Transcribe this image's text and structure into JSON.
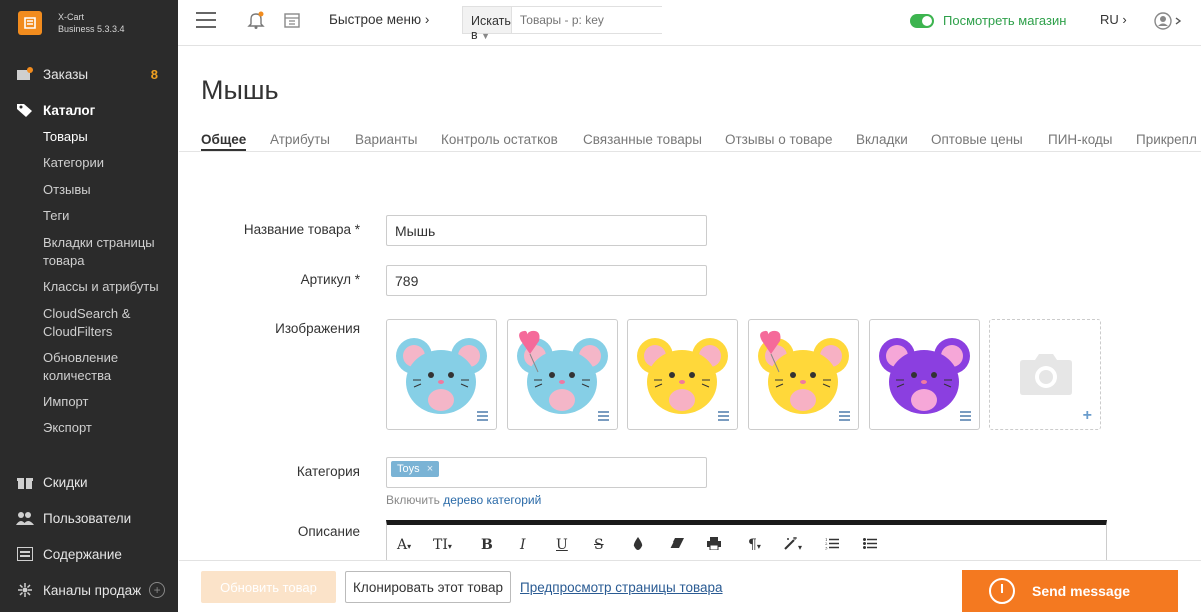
{
  "brand": {
    "name": "X-Cart",
    "edition": "Business 5.3.3.4"
  },
  "sidebar": {
    "orders": {
      "label": "Заказы",
      "badge": "8"
    },
    "catalog": {
      "label": "Каталог"
    },
    "catalog_items": [
      {
        "label": "Товары"
      },
      {
        "label": "Категории"
      },
      {
        "label": "Отзывы"
      },
      {
        "label": "Теги"
      },
      {
        "label": "Вкладки страницы товара"
      },
      {
        "label": "Классы и атрибуты"
      },
      {
        "label": "CloudSearch & CloudFilters"
      },
      {
        "label": "Обновление количества"
      },
      {
        "label": "Импорт"
      },
      {
        "label": "Экспорт"
      }
    ],
    "discounts": {
      "label": "Скидки"
    },
    "users": {
      "label": "Пользователи"
    },
    "content": {
      "label": "Содержание"
    },
    "channels": {
      "label": "Каналы продаж"
    }
  },
  "topbar": {
    "quick_menu": "Быстрое меню",
    "search_scope": "Искать в",
    "search_placeholder": "Товары - p: key",
    "view_store": "Посмотреть магазин",
    "language": "RU"
  },
  "page": {
    "title": "Мышь",
    "tabs": [
      {
        "label": "Общее"
      },
      {
        "label": "Атрибуты"
      },
      {
        "label": "Варианты"
      },
      {
        "label": "Контроль остатков"
      },
      {
        "label": "Связанные товары"
      },
      {
        "label": "Отзывы о товаре"
      },
      {
        "label": "Вкладки"
      },
      {
        "label": "Оптовые цены"
      },
      {
        "label": "ПИН-коды"
      },
      {
        "label": "Прикрепл"
      }
    ]
  },
  "form": {
    "name_label": "Название товара *",
    "name_value": "Мышь",
    "sku_label": "Артикул *",
    "sku_value": "789",
    "images_label": "Изображения",
    "images": [
      {
        "body": "#86cfe6",
        "ear": "#86cfe6",
        "inner": "#f4b6c8",
        "heart": false
      },
      {
        "body": "#86cfe6",
        "ear": "#86cfe6",
        "inner": "#f4b6c8",
        "heart": true
      },
      {
        "body": "#ffd83a",
        "ear": "#ffd83a",
        "inner": "#f7b1c4",
        "heart": false
      },
      {
        "body": "#ffd83a",
        "ear": "#ffd83a",
        "inner": "#f7b1c4",
        "heart": true
      },
      {
        "body": "#8b3fe0",
        "ear": "#8b3fe0",
        "inner": "#f6a7d8",
        "heart": false
      }
    ],
    "category_label": "Категория",
    "category_tag": "Toys",
    "category_hint": "Включить",
    "category_tree_link": "дерево категорий",
    "description_label": "Описание"
  },
  "editor_toolbar": [
    "A",
    "TI",
    "B",
    "I",
    "U",
    "S",
    "color",
    "eraser",
    "print",
    "paragraph",
    "magic",
    "ol",
    "ul"
  ],
  "bottom": {
    "update_button": "Обновить товар",
    "clone_button": "Клонировать этот товар",
    "preview_link": "Предпросмотр страницы товара"
  },
  "chat": {
    "label": "Send message"
  }
}
